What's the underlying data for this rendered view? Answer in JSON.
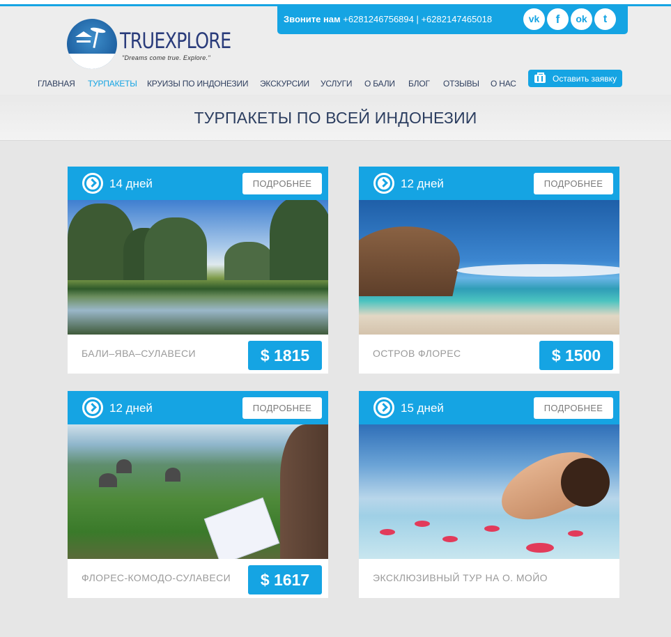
{
  "header": {
    "brand": "TRUEXPLORE",
    "tagline": "\"Dreams come true. Explore.\"",
    "call_label": "Звоните нам",
    "phones": "+6281246756894 | +6282147465018",
    "social": [
      {
        "name": "vk",
        "glyph": "vk"
      },
      {
        "name": "facebook",
        "glyph": "f"
      },
      {
        "name": "odnoklassniki",
        "glyph": "ok"
      },
      {
        "name": "twitter",
        "glyph": "t"
      }
    ]
  },
  "nav": {
    "items": [
      {
        "label": "ГЛАВНАЯ",
        "active": false
      },
      {
        "label": "ТУРПАКЕТЫ",
        "active": true
      },
      {
        "label": "КРУИЗЫ ПО ИНДОНЕЗИИ",
        "active": false
      },
      {
        "label": "ЭКСКУРСИИ",
        "active": false
      },
      {
        "label": "УСЛУГИ",
        "active": false
      },
      {
        "label": "О БАЛИ",
        "active": false
      },
      {
        "label": "БЛОГ",
        "active": false
      },
      {
        "label": "ОТЗЫВЫ",
        "active": false
      },
      {
        "label": "О НАС",
        "active": false
      }
    ],
    "order_button": "Оставить заявку"
  },
  "page_title": "ТУРПАКЕТЫ ПО ВСЕЙ ИНДОНЕЗИИ",
  "tours": [
    {
      "days": "14 дней",
      "more": "ПОДРОБНЕЕ",
      "name": "БАЛИ–ЯВА–СУЛАВЕСИ",
      "price": "$ 1815"
    },
    {
      "days": "12 дней",
      "more": "ПОДРОБНЕЕ",
      "name": "ОСТРОВ ФЛОРЕС",
      "price": "$ 1500"
    },
    {
      "days": "12 дней",
      "more": "ПОДРОБНЕЕ",
      "name": "ФЛОРЕС-КОМОДО-СУЛАВЕСИ",
      "price": "$ 1617"
    },
    {
      "days": "15 дней",
      "more": "ПОДРОБНЕЕ",
      "name": "ЭКСКЛЮЗИВНЫЙ ТУР НА О. МОЙО",
      "price": ""
    }
  ],
  "colors": {
    "accent": "#15a4e3",
    "nav_text": "#2f3f5f",
    "title_text": "#2c3e60"
  }
}
